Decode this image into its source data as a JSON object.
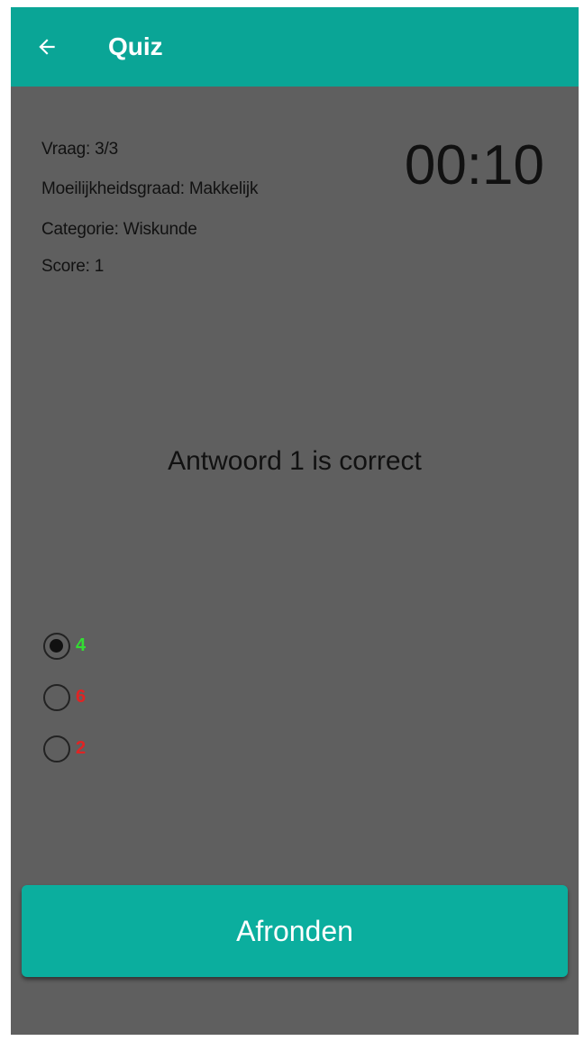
{
  "appbar": {
    "title": "Quiz",
    "back_icon": "arrow-left-icon",
    "color": "#0aa596"
  },
  "info": {
    "question": "Vraag: 3/3",
    "difficulty": "Moeilijkheidsgraad: Makkelijk",
    "category": "Categorie: Wiskunde",
    "score": "Score: 1"
  },
  "timer": "00:10",
  "result_text": "Antwoord 1 is correct",
  "options": [
    {
      "label": "4",
      "color": "#33dd33",
      "selected": true
    },
    {
      "label": "6",
      "color": "#e02424",
      "selected": false
    },
    {
      "label": "2",
      "color": "#e02424",
      "selected": false
    }
  ],
  "finish_button": {
    "label": "Afronden",
    "color": "#0bae9e"
  },
  "background_color": "#5f5f5f"
}
